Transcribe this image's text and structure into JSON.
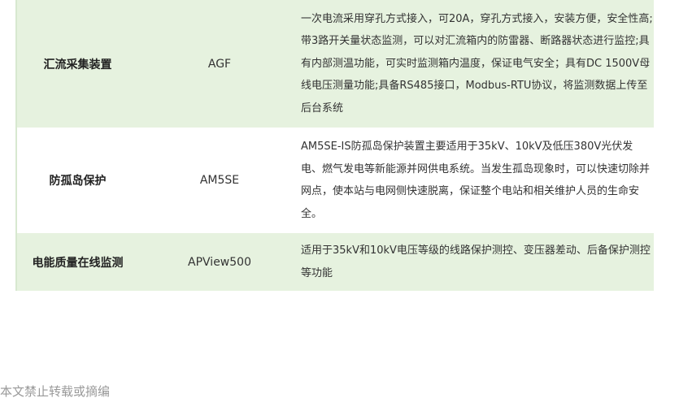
{
  "table": {
    "rows": [
      {
        "name": "汇流采集装置",
        "model": "AGF",
        "description": "一次电流采用穿孔方式接入，可20A，穿孔方式接入，安装方便，安全性高;带3路开关量状态监测，可以对汇流箱内的防雷器、断路器状态进行监控;具有内部测温功能，可实时监测箱内温度，保证电气安全；具有DC 1500V母线电压测量功能;具备RS485接口，Modbus-RTU协议，将监测数据上传至后台系统"
      },
      {
        "name": "防孤岛保护",
        "model": "AM5SE",
        "description": "AM5SE-IS防孤岛保护装置主要适用于35kV、10kV及低压380V光伏发电、燃气发电等新能源并网供电系统。当发生孤岛现象时，可以快速切除并网点，使本站与电网侧快速脱离，保证整个电站和相关维护人员的生命安全。"
      },
      {
        "name": "电能质量在线监测",
        "model": "APView500",
        "description": "适用于35kV和10kV电压等级的线路保护测控、变压器差动、后备保护测控等功能"
      }
    ],
    "colors": {
      "shaded_row": "#e6f2df",
      "plain_row": "#ffffff"
    }
  },
  "footer": {
    "note": "本文禁止转载或摘编"
  }
}
